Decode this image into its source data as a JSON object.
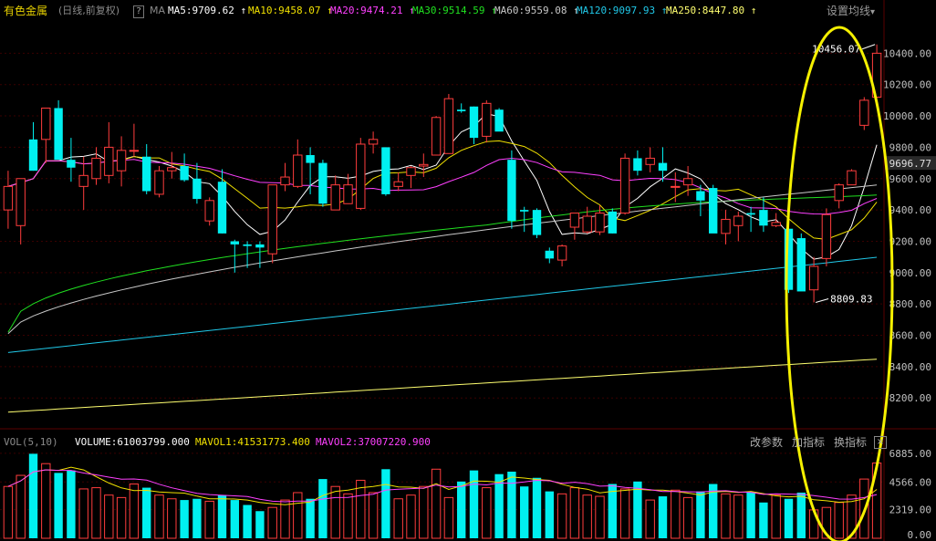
{
  "header": {
    "title": "有色金属",
    "subtitle": "(日线,前复权)",
    "help_label": "?",
    "ma_label": "MA",
    "ma_items": [
      {
        "text": "MA5:9709.62",
        "color": "#ffffff"
      },
      {
        "text": "MA10:9458.07",
        "color": "#f0e000"
      },
      {
        "text": "MA20:9474.21",
        "color": "#ff40ff"
      },
      {
        "text": "MA30:9514.59",
        "color": "#20e020"
      },
      {
        "text": "MA60:9559.08",
        "color": "#c8c8c8"
      },
      {
        "text": "MA120:9097.93",
        "color": "#20c8e8"
      },
      {
        "text": "MA250:8447.80",
        "color": "#ffff70"
      }
    ],
    "settings_label": "设置均线",
    "settings_arrow": "▾"
  },
  "price_axis": {
    "ticks": [
      "10400.00",
      "10200.00",
      "10000.00",
      "9800.00",
      "9600.00",
      "9400.00",
      "9200.00",
      "9000.00",
      "8800.00",
      "8600.00",
      "8400.00",
      "8200.00"
    ],
    "current_price": "9696.77"
  },
  "annotations": {
    "high_label": "10456.07",
    "low_label": "8809.83"
  },
  "volume_header": {
    "label": "VOL(5,10)",
    "volume": "VOLUME:61003799.000",
    "mavol1": "MAVOL1:41531773.400",
    "mavol2": "MAVOL2:37007220.900",
    "btn_params": "改参数",
    "btn_add": "加指标",
    "btn_switch": "换指标",
    "btn_close": "×"
  },
  "volume_axis": {
    "ticks": [
      "6885.00",
      "4566.00",
      "2319.00",
      "0.00"
    ]
  },
  "colors": {
    "up": "#ff3d3d",
    "down": "#00f0f0",
    "ellipse": "#f5f000",
    "axis_text": "#c0c0c0",
    "grid": "#3a0000"
  },
  "chart_data": {
    "type": "candlestick",
    "price_ylim": [
      8050,
      10600
    ],
    "volume_ylim": [
      0,
      7100
    ],
    "candles": [
      {
        "o": 9400,
        "h": 9650,
        "l": 9280,
        "c": 9550,
        "v": 4200
      },
      {
        "o": 9300,
        "h": 9550,
        "l": 9180,
        "c": 9600,
        "v": 5100
      },
      {
        "o": 9850,
        "h": 9960,
        "l": 9650,
        "c": 9650,
        "v": 6850
      },
      {
        "o": 9850,
        "h": 10050,
        "l": 9700,
        "c": 10050,
        "v": 6050
      },
      {
        "o": 10050,
        "h": 10100,
        "l": 9820,
        "c": 9720,
        "v": 5300
      },
      {
        "o": 9720,
        "h": 9860,
        "l": 9580,
        "c": 9670,
        "v": 5500
      },
      {
        "o": 9550,
        "h": 9740,
        "l": 9400,
        "c": 9620,
        "v": 4000
      },
      {
        "o": 9600,
        "h": 9800,
        "l": 9560,
        "c": 9730,
        "v": 4100
      },
      {
        "o": 9620,
        "h": 9960,
        "l": 9570,
        "c": 9800,
        "v": 3500
      },
      {
        "o": 9650,
        "h": 9870,
        "l": 9550,
        "c": 9780,
        "v": 3300
      },
      {
        "o": 9780,
        "h": 9950,
        "l": 9740,
        "c": 9780,
        "v": 4400
      },
      {
        "o": 9740,
        "h": 9820,
        "l": 9500,
        "c": 9520,
        "v": 4100
      },
      {
        "o": 9500,
        "h": 9680,
        "l": 9480,
        "c": 9650,
        "v": 3500
      },
      {
        "o": 9650,
        "h": 9770,
        "l": 9600,
        "c": 9670,
        "v": 3200
      },
      {
        "o": 9680,
        "h": 9760,
        "l": 9580,
        "c": 9590,
        "v": 3100
      },
      {
        "o": 9600,
        "h": 9700,
        "l": 9440,
        "c": 9470,
        "v": 3200
      },
      {
        "o": 9330,
        "h": 9480,
        "l": 9300,
        "c": 9460,
        "v": 3000
      },
      {
        "o": 9580,
        "h": 9660,
        "l": 9250,
        "c": 9250,
        "v": 3500
      },
      {
        "o": 9200,
        "h": 9210,
        "l": 9000,
        "c": 9180,
        "v": 3100
      },
      {
        "o": 9180,
        "h": 9200,
        "l": 9030,
        "c": 9170,
        "v": 2700
      },
      {
        "o": 9180,
        "h": 9200,
        "l": 9030,
        "c": 9160,
        "v": 2200
      },
      {
        "o": 9120,
        "h": 9560,
        "l": 9060,
        "c": 9560,
        "v": 2500
      },
      {
        "o": 9560,
        "h": 9700,
        "l": 9520,
        "c": 9610,
        "v": 3100
      },
      {
        "o": 9550,
        "h": 9850,
        "l": 9540,
        "c": 9750,
        "v": 3700
      },
      {
        "o": 9750,
        "h": 9800,
        "l": 9500,
        "c": 9700,
        "v": 3200
      },
      {
        "o": 9700,
        "h": 9720,
        "l": 9420,
        "c": 9440,
        "v": 4800
      },
      {
        "o": 9400,
        "h": 9620,
        "l": 9400,
        "c": 9560,
        "v": 4200
      },
      {
        "o": 9440,
        "h": 9630,
        "l": 9480,
        "c": 9560,
        "v": 3600
      },
      {
        "o": 9410,
        "h": 9860,
        "l": 9400,
        "c": 9820,
        "v": 4700
      },
      {
        "o": 9820,
        "h": 9900,
        "l": 9760,
        "c": 9850,
        "v": 3700
      },
      {
        "o": 9800,
        "h": 9800,
        "l": 9490,
        "c": 9500,
        "v": 5600
      },
      {
        "o": 9550,
        "h": 9640,
        "l": 9520,
        "c": 9580,
        "v": 3200
      },
      {
        "o": 9620,
        "h": 9680,
        "l": 9540,
        "c": 9670,
        "v": 3500
      },
      {
        "o": 9680,
        "h": 9760,
        "l": 9610,
        "c": 9690,
        "v": 4200
      },
      {
        "o": 9750,
        "h": 10000,
        "l": 9750,
        "c": 9990,
        "v": 5600
      },
      {
        "o": 9760,
        "h": 10140,
        "l": 9760,
        "c": 10110,
        "v": 3300
      },
      {
        "o": 10040,
        "h": 10080,
        "l": 10020,
        "c": 10030,
        "v": 4600
      },
      {
        "o": 10060,
        "h": 10060,
        "l": 9820,
        "c": 9860,
        "v": 5500
      },
      {
        "o": 9870,
        "h": 10100,
        "l": 9830,
        "c": 10080,
        "v": 4100
      },
      {
        "o": 10040,
        "h": 10050,
        "l": 9920,
        "c": 9900,
        "v": 5200
      },
      {
        "o": 9720,
        "h": 9780,
        "l": 9280,
        "c": 9330,
        "v": 5400
      },
      {
        "o": 9400,
        "h": 9420,
        "l": 9260,
        "c": 9390,
        "v": 4200
      },
      {
        "o": 9400,
        "h": 9410,
        "l": 9220,
        "c": 9240,
        "v": 4900
      },
      {
        "o": 9140,
        "h": 9160,
        "l": 9060,
        "c": 9090,
        "v": 3800
      },
      {
        "o": 9080,
        "h": 9180,
        "l": 9040,
        "c": 9170,
        "v": 3600
      },
      {
        "o": 9290,
        "h": 9380,
        "l": 9210,
        "c": 9380,
        "v": 4100
      },
      {
        "o": 9260,
        "h": 9420,
        "l": 9250,
        "c": 9360,
        "v": 3500
      },
      {
        "o": 9260,
        "h": 9430,
        "l": 9240,
        "c": 9380,
        "v": 3400
      },
      {
        "o": 9390,
        "h": 9410,
        "l": 9250,
        "c": 9250,
        "v": 4400
      },
      {
        "o": 9380,
        "h": 9760,
        "l": 9370,
        "c": 9730,
        "v": 4000
      },
      {
        "o": 9730,
        "h": 9780,
        "l": 9620,
        "c": 9650,
        "v": 4600
      },
      {
        "o": 9690,
        "h": 9800,
        "l": 9640,
        "c": 9730,
        "v": 3100
      },
      {
        "o": 9700,
        "h": 9800,
        "l": 9580,
        "c": 9650,
        "v": 3400
      },
      {
        "o": 9550,
        "h": 9640,
        "l": 9450,
        "c": 9550,
        "v": 3900
      },
      {
        "o": 9560,
        "h": 9680,
        "l": 9490,
        "c": 9600,
        "v": 3300
      },
      {
        "o": 9520,
        "h": 9560,
        "l": 9360,
        "c": 9460,
        "v": 3800
      },
      {
        "o": 9540,
        "h": 9560,
        "l": 9320,
        "c": 9250,
        "v": 4400
      },
      {
        "o": 9250,
        "h": 9400,
        "l": 9180,
        "c": 9340,
        "v": 3600
      },
      {
        "o": 9300,
        "h": 9390,
        "l": 9200,
        "c": 9360,
        "v": 3500
      },
      {
        "o": 9380,
        "h": 9420,
        "l": 9260,
        "c": 9370,
        "v": 3700
      },
      {
        "o": 9400,
        "h": 9480,
        "l": 9260,
        "c": 9300,
        "v": 2900
      },
      {
        "o": 9300,
        "h": 9380,
        "l": 9290,
        "c": 9320,
        "v": 3500
      },
      {
        "o": 9280,
        "h": 9360,
        "l": 8870,
        "c": 8890,
        "v": 3200
      },
      {
        "o": 9220,
        "h": 9250,
        "l": 8890,
        "c": 8880,
        "v": 3700
      },
      {
        "o": 8890,
        "h": 9100,
        "l": 8810,
        "c": 9040,
        "v": 2300
      },
      {
        "o": 9090,
        "h": 9410,
        "l": 9040,
        "c": 9370,
        "v": 2500
      },
      {
        "o": 9460,
        "h": 9570,
        "l": 9410,
        "c": 9560,
        "v": 2900
      },
      {
        "o": 9560,
        "h": 9660,
        "l": 9560,
        "c": 9650,
        "v": 3500
      },
      {
        "o": 9940,
        "h": 10120,
        "l": 9910,
        "c": 10100,
        "v": 4800
      },
      {
        "o": 10120,
        "h": 10456,
        "l": 10110,
        "c": 10400,
        "v": 6100
      }
    ]
  }
}
